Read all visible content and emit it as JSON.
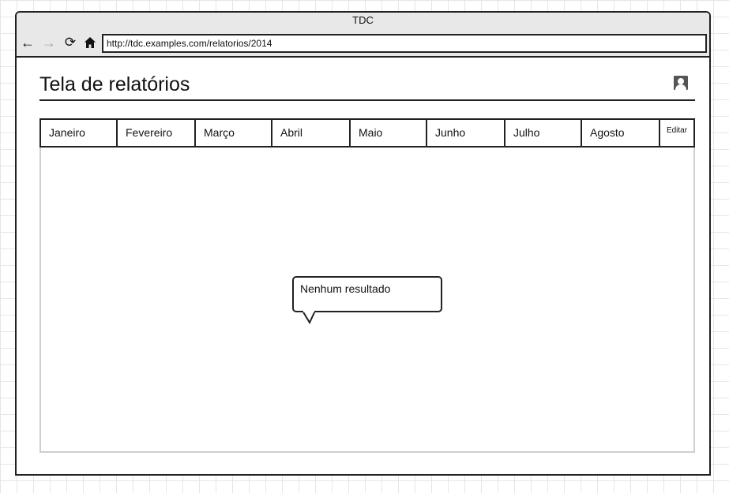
{
  "window": {
    "title": "TDC"
  },
  "navigation": {
    "back_icon": "arrow-left-icon",
    "forward_icon": "arrow-right-icon",
    "reload_icon": "reload-icon",
    "home_icon": "home-icon",
    "address": "http://tdc.examples.com/relatorios/2014"
  },
  "page": {
    "title": "Tela de relatórios",
    "user_icon": "user-icon"
  },
  "tabs": [
    {
      "label": "Janeiro"
    },
    {
      "label": "Fevereiro"
    },
    {
      "label": "Março"
    },
    {
      "label": "Abril"
    },
    {
      "label": "Maio"
    },
    {
      "label": "Junho"
    },
    {
      "label": "Julho"
    },
    {
      "label": "Agosto"
    }
  ],
  "edit_tab": {
    "label": "Editar"
  },
  "tooltip": {
    "text": "Nenhum resultado"
  }
}
